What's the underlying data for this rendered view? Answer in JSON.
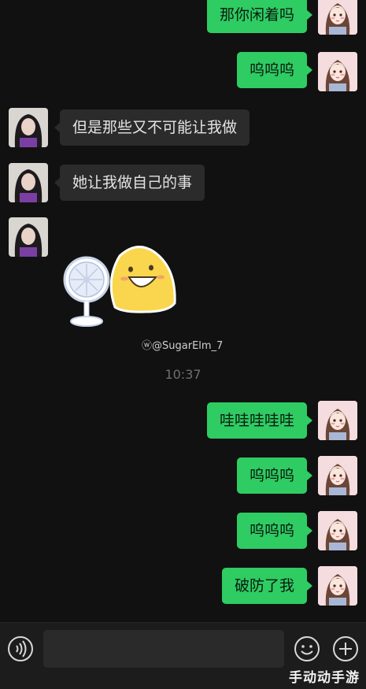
{
  "messages": [
    {
      "from": "me",
      "text": "那你闲着吗"
    },
    {
      "from": "me",
      "text": "呜呜呜"
    },
    {
      "from": "other",
      "text": "但是那些又不可能让我做"
    },
    {
      "from": "other",
      "text": "她让我做自己的事"
    },
    {
      "from": "other",
      "type": "sticker",
      "sticker_name": "fan-and-yellow-blob"
    },
    {
      "from": "me",
      "text": "哇哇哇哇哇"
    },
    {
      "from": "me",
      "text": "呜呜呜"
    },
    {
      "from": "me",
      "text": "呜呜呜"
    },
    {
      "from": "me",
      "text": "破防了我"
    }
  ],
  "timestamp": "10:37",
  "watermark": "@SugarElm_7",
  "toolbar": {
    "voice_icon": "voice-icon",
    "emoji_icon": "emoji-icon",
    "add_icon": "add-icon"
  },
  "corner_mark": "手动动手游",
  "colors": {
    "my_bubble": "#2ecc63",
    "other_bubble": "#2b2b2b",
    "background": "#111111"
  }
}
